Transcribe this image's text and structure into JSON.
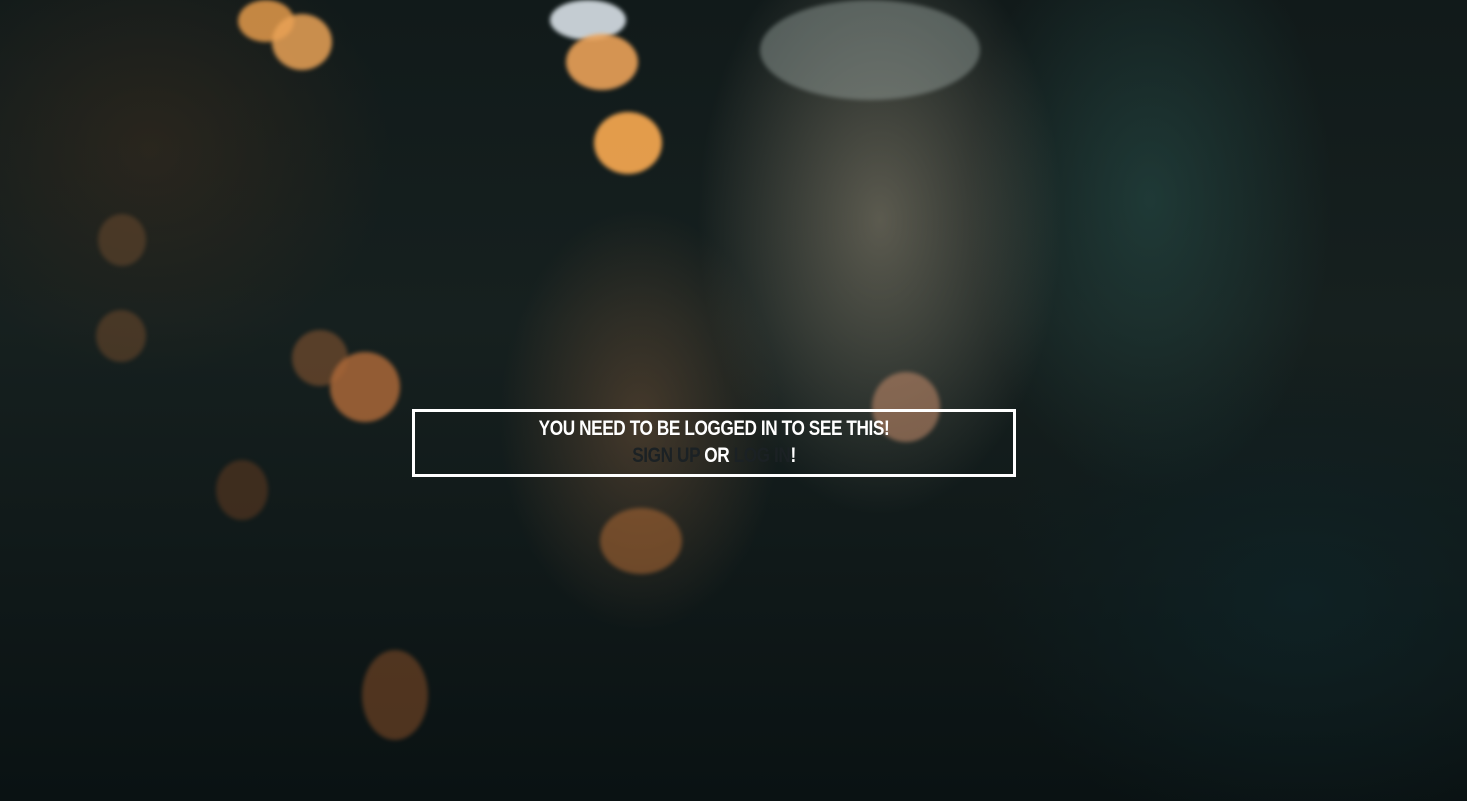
{
  "notice": {
    "message": "You need to be logged in to see this!",
    "signup_link": "Sign up",
    "separator": " or ",
    "login_link": "Log in",
    "end_punctuation": "!"
  },
  "colors": {
    "text": "#ffffff",
    "link": "#1b2124",
    "border": "#ffffff"
  }
}
